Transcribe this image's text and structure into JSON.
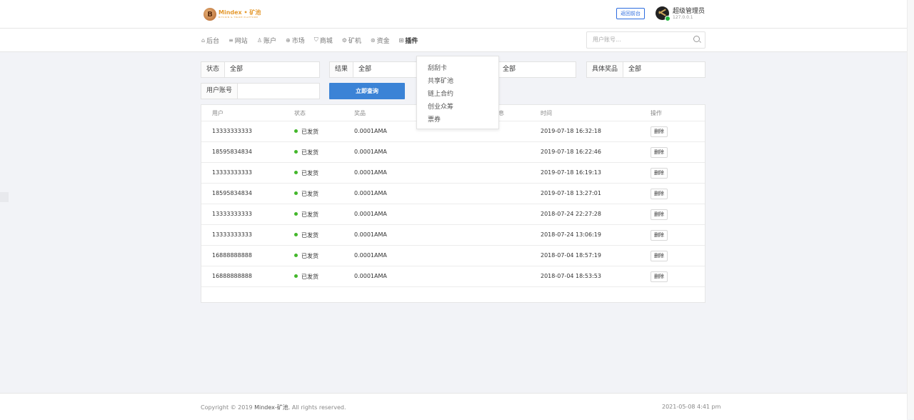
{
  "header": {
    "logo_letter": "B",
    "logo_name": "Mindex • 矿池",
    "logo_sub": "BITCOIN & TRADE PLATFORM",
    "front_button": "返回前台",
    "admin_name": "超级管理员",
    "admin_ip": "127.0.0.1"
  },
  "nav": {
    "items": [
      {
        "label": "后台",
        "icon": "home-icon"
      },
      {
        "label": "网站",
        "icon": "list-icon"
      },
      {
        "label": "账户",
        "icon": "user-icon"
      },
      {
        "label": "市场",
        "icon": "globe-icon"
      },
      {
        "label": "商城",
        "icon": "cart-icon"
      },
      {
        "label": "矿机",
        "icon": "gear-icon"
      },
      {
        "label": "资金",
        "icon": "coin-icon"
      },
      {
        "label": "插件",
        "icon": "grid-icon"
      }
    ],
    "active_index": 7,
    "search_placeholder": "用户账号..."
  },
  "dropdown": {
    "items": [
      "刮刮卡",
      "共享矿池",
      "链上合约",
      "创业众筹",
      "票券"
    ]
  },
  "filters": {
    "status_label": "状态",
    "status_value": "全部",
    "result_label": "结果",
    "result_value": "全部",
    "third_value": "全部",
    "prize_label": "具体奖品",
    "prize_value": "全部",
    "account_label": "用户账号",
    "account_value": "",
    "query_button": "立即查询"
  },
  "table": {
    "headers": [
      "用户",
      "状态",
      "奖品",
      "息",
      "时间",
      "操作"
    ],
    "rows": [
      {
        "user": "13333333333",
        "status": "已发货",
        "prize": "0.0001AMA",
        "time": "2019-07-18 16:32:18",
        "action": "删除"
      },
      {
        "user": "18595834834",
        "status": "已发货",
        "prize": "0.0001AMA",
        "time": "2019-07-18 16:22:46",
        "action": "删除"
      },
      {
        "user": "13333333333",
        "status": "已发货",
        "prize": "0.0001AMA",
        "time": "2019-07-18 16:19:13",
        "action": "删除"
      },
      {
        "user": "18595834834",
        "status": "已发货",
        "prize": "0.0001AMA",
        "time": "2019-07-18 13:27:01",
        "action": "删除"
      },
      {
        "user": "13333333333",
        "status": "已发货",
        "prize": "0.0001AMA",
        "time": "2018-07-24 22:27:28",
        "action": "删除"
      },
      {
        "user": "13333333333",
        "status": "已发货",
        "prize": "0.0001AMA",
        "time": "2018-07-24 13:06:19",
        "action": "删除"
      },
      {
        "user": "16888888888",
        "status": "已发货",
        "prize": "0.0001AMA",
        "time": "2018-07-04 18:57:19",
        "action": "删除"
      },
      {
        "user": "16888888888",
        "status": "已发货",
        "prize": "0.0001AMA",
        "time": "2018-07-04 18:53:53",
        "action": "删除"
      }
    ]
  },
  "footer": {
    "copyright_prefix": "Copyright © 2019",
    "brand": "Mindex-矿池.",
    "copyright_suffix": "All rights reserved.",
    "datetime": "2021-05-08 4:41 pm"
  },
  "colors": {
    "primary": "#3b83d6",
    "status_green": "#43b72b",
    "logo_orange": "#e59a2f"
  }
}
